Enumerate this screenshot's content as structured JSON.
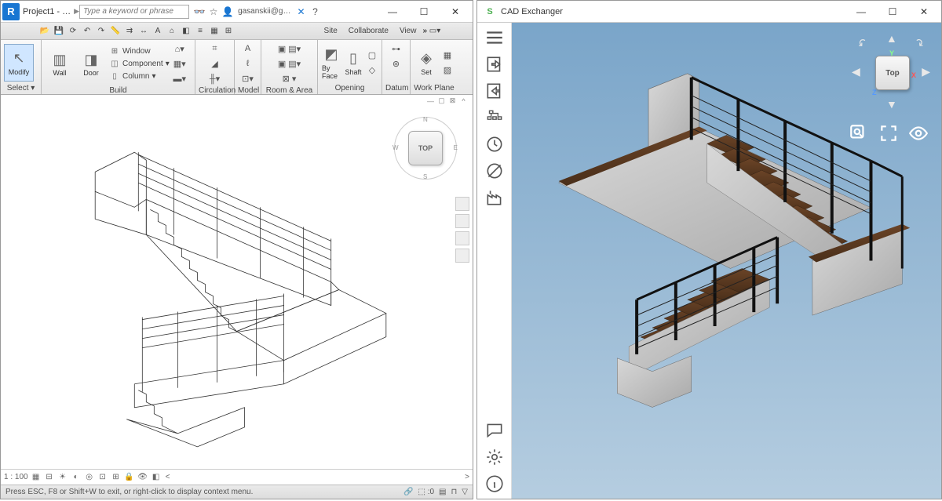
{
  "left": {
    "title": "Project1 - …",
    "search_placeholder": "Type a keyword or phrase",
    "user": "gasanskii@g…",
    "tabs": {
      "site": "Site",
      "collaborate": "Collaborate",
      "view": "View"
    },
    "ribbon": {
      "select": "Select",
      "modify": "Modify",
      "build": "Build",
      "wall": "Wall",
      "door": "Door",
      "window": "Window",
      "component": "Component",
      "column": "Column",
      "circulation": "Circulation",
      "model": "Model",
      "room_area": "Room & Area",
      "opening": "Opening",
      "by_face": "By Face",
      "shaft": "Shaft",
      "datum": "Datum",
      "work_plane": "Work Plane",
      "set": "Set"
    },
    "scale": "1 : 100",
    "cube": "TOP",
    "status": "Press ESC, F8 or Shift+W to exit, or right-click to display context menu.",
    "status_sel": ":0"
  },
  "right": {
    "title": "CAD Exchanger",
    "cube": "Top",
    "axes": {
      "x": "X",
      "y": "Y",
      "z": "Z"
    }
  }
}
